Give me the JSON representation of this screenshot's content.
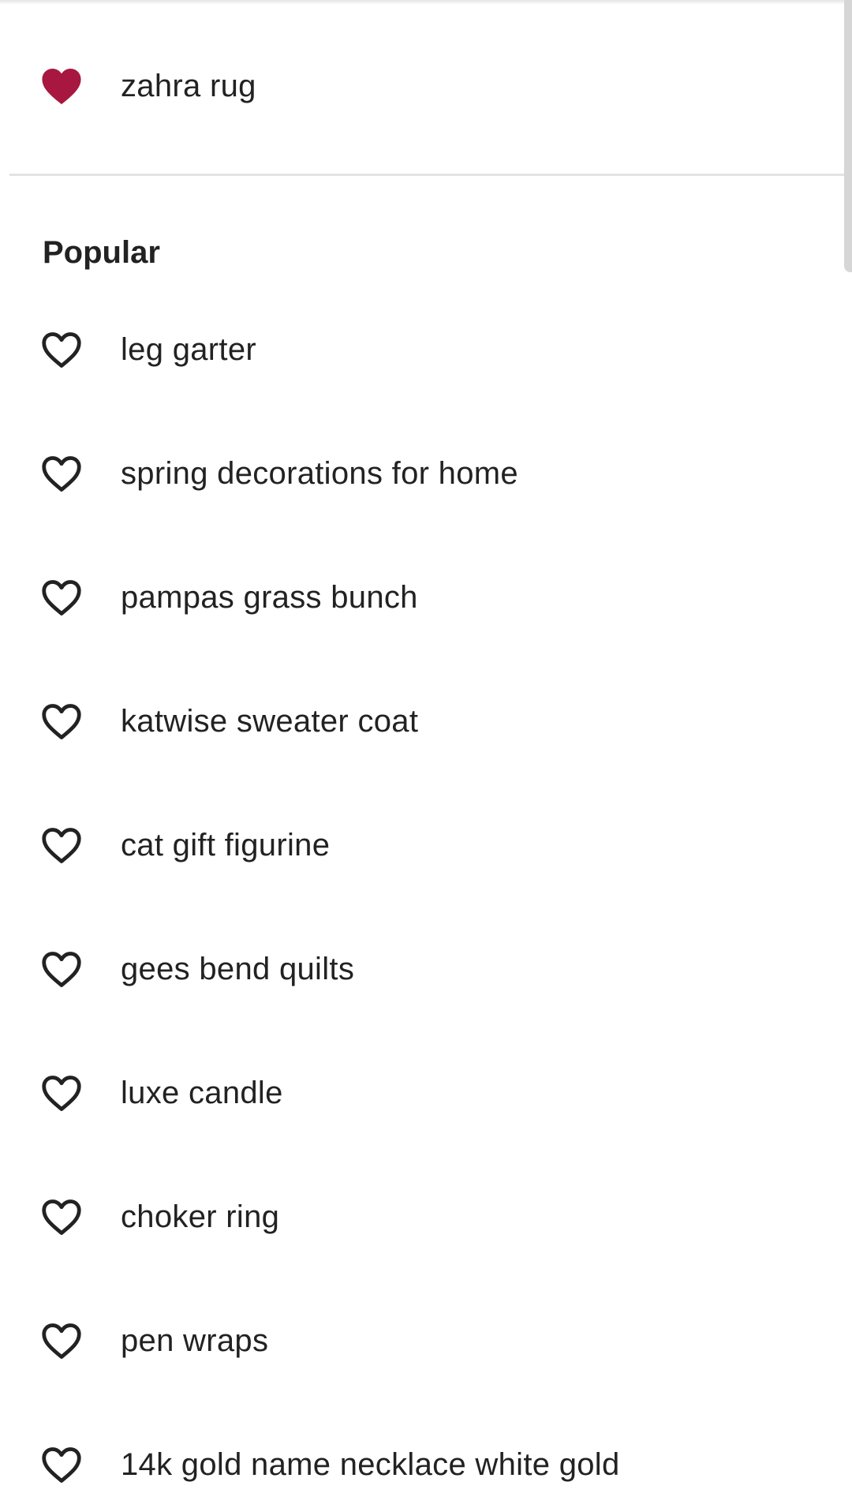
{
  "saved": {
    "item": {
      "label": "zahra rug",
      "icon": "heart-filled-icon",
      "favorited": true
    }
  },
  "popular": {
    "title": "Popular",
    "items": [
      {
        "label": "leg garter",
        "icon": "heart-outline-icon"
      },
      {
        "label": "spring decorations for home",
        "icon": "heart-outline-icon"
      },
      {
        "label": "pampas grass bunch",
        "icon": "heart-outline-icon"
      },
      {
        "label": "katwise sweater coat",
        "icon": "heart-outline-icon"
      },
      {
        "label": "cat gift figurine",
        "icon": "heart-outline-icon"
      },
      {
        "label": "gees bend quilts",
        "icon": "heart-outline-icon"
      },
      {
        "label": "luxe candle",
        "icon": "heart-outline-icon"
      },
      {
        "label": "choker ring",
        "icon": "heart-outline-icon"
      },
      {
        "label": "pen wraps",
        "icon": "heart-outline-icon"
      },
      {
        "label": "14k gold name necklace white gold",
        "icon": "heart-outline-icon"
      }
    ]
  },
  "colors": {
    "heart_filled": "#a8173f",
    "text": "#222222",
    "divider": "#e3e3e3"
  }
}
